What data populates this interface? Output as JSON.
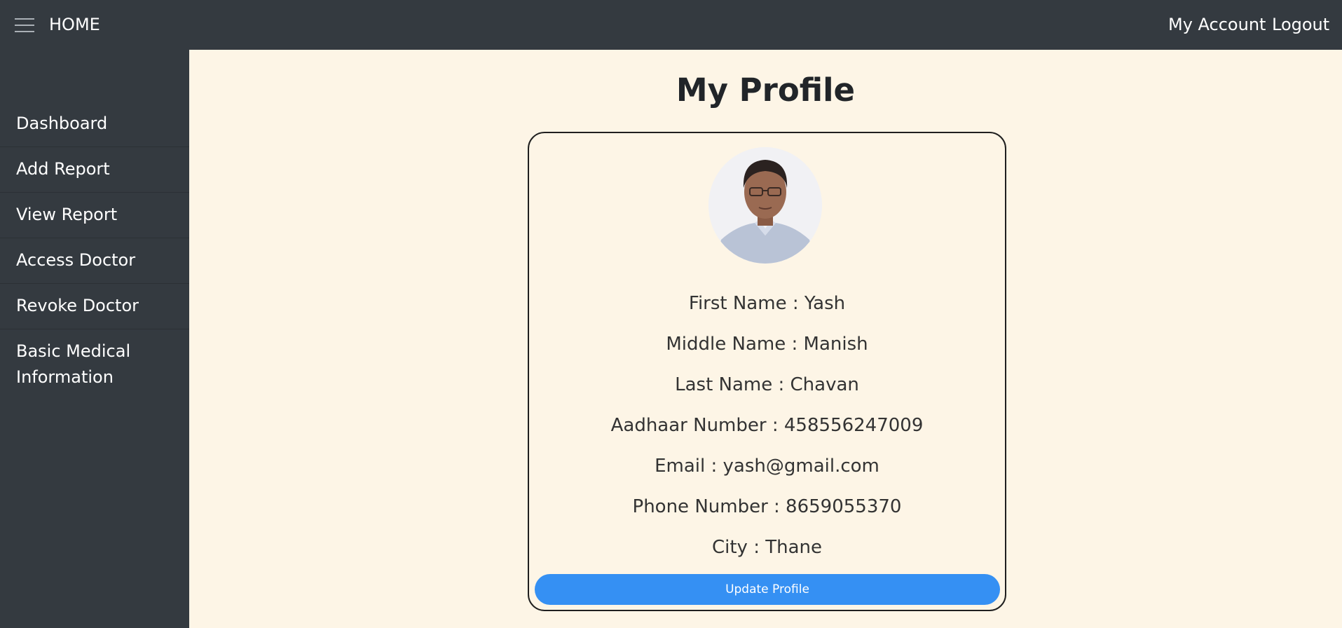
{
  "topbar": {
    "menu_icon": "hamburger-menu-icon",
    "brand": "HOME",
    "links": [
      {
        "label": "My Account"
      },
      {
        "label": "Logout"
      }
    ],
    "background": "#343a40"
  },
  "sidebar": {
    "items": [
      {
        "label": "Dashboard"
      },
      {
        "label": "Add Report"
      },
      {
        "label": "View Report"
      },
      {
        "label": "Access Doctor"
      },
      {
        "label": "Revoke Doctor"
      },
      {
        "label": "Basic Medical Information"
      }
    ]
  },
  "main": {
    "title": "My Profile",
    "background": "#fdf5e6",
    "profile": {
      "avatar_icon": "user-photo-avatar",
      "fields": [
        {
          "text": "First Name : Yash"
        },
        {
          "text": "Middle Name : Manish"
        },
        {
          "text": "Last Name : Chavan"
        },
        {
          "text": "Aadhaar Number : 458556247009"
        },
        {
          "text": "Email : yash@gmail.com"
        },
        {
          "text": "Phone Number : 8659055370"
        },
        {
          "text": "City : Thane"
        }
      ],
      "update_button": "Update Profile",
      "button_color": "#3590f3"
    }
  }
}
